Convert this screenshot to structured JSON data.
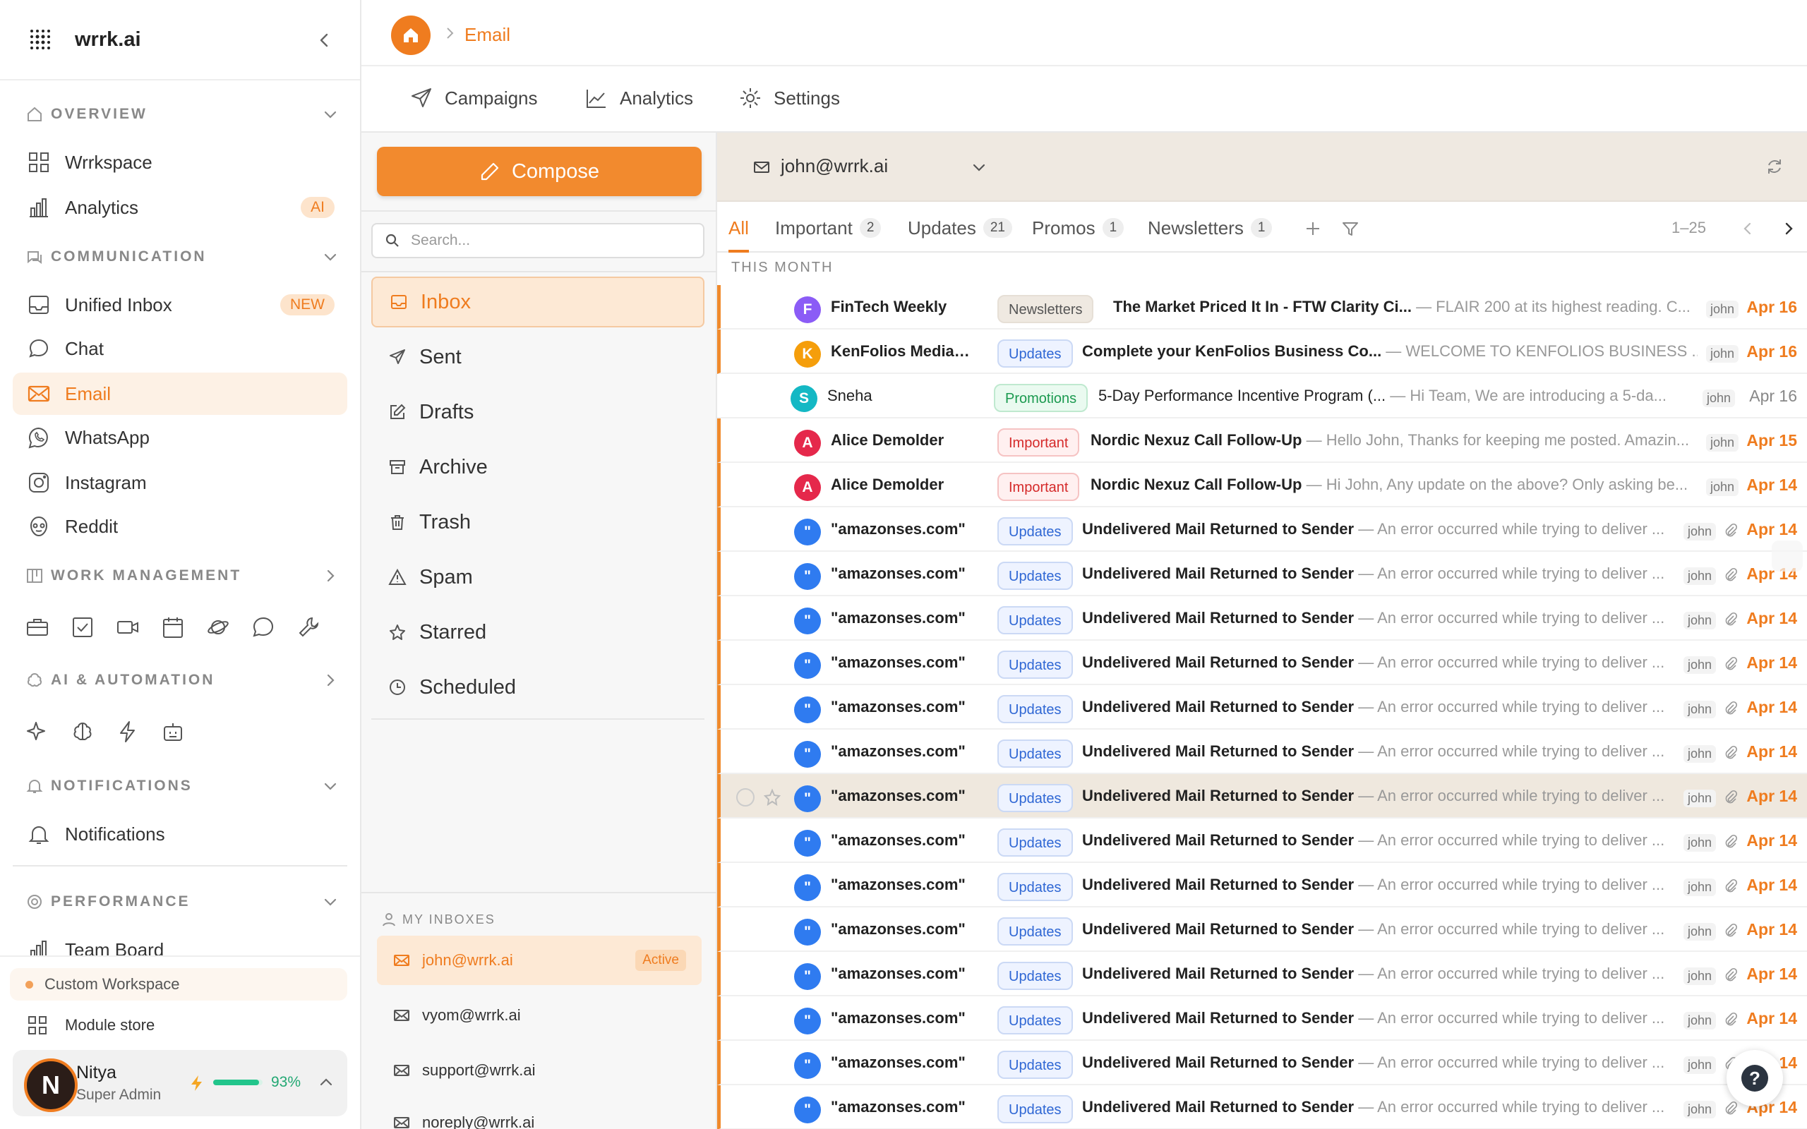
{
  "brand": {
    "name": "wrrk.ai"
  },
  "sidebar": {
    "sections": {
      "overview": "OVERVIEW",
      "communication": "COMMUNICATION",
      "work_management": "WORK MANAGEMENT",
      "ai_automation": "AI & AUTOMATION",
      "notifications": "NOTIFICATIONS",
      "performance": "PERFORMANCE"
    },
    "overview_items": [
      {
        "label": "Wrrkspace",
        "icon": "grid-icon"
      },
      {
        "label": "Analytics",
        "icon": "bar-chart-icon",
        "badge": "AI"
      }
    ],
    "communication_items": [
      {
        "label": "Unified Inbox",
        "icon": "inbox-icon",
        "badge": "NEW"
      },
      {
        "label": "Chat",
        "icon": "chat-bubble-icon"
      },
      {
        "label": "Email",
        "icon": "mail-icon"
      },
      {
        "label": "WhatsApp",
        "icon": "whatsapp-icon"
      },
      {
        "label": "Instagram",
        "icon": "instagram-icon"
      },
      {
        "label": "Reddit",
        "icon": "reddit-icon"
      }
    ],
    "work_icons": [
      "briefcase-icon",
      "checkbox-icon",
      "video-icon",
      "calendar-icon",
      "planet-icon",
      "message-icon",
      "wrench-icon"
    ],
    "ai_icons": [
      "sparkle-icon",
      "brain-icon",
      "lightning-icon",
      "bot-icon"
    ],
    "notifications_item": "Notifications",
    "performance_item": "Team Board",
    "custom_workspace": "Custom Workspace",
    "module_store": "Module store",
    "user": {
      "initial": "N",
      "name": "Nitya",
      "role": "Super Admin",
      "progress": "93%",
      "progress_value": 0.93
    }
  },
  "header": {
    "breadcrumb": "Email"
  },
  "top_tabs": [
    "Campaigns",
    "Analytics",
    "Settings"
  ],
  "folders": {
    "compose": "Compose",
    "search_placeholder": "Search...",
    "items": [
      "Inbox",
      "Sent",
      "Drafts",
      "Archive",
      "Trash",
      "Spam",
      "Starred",
      "Scheduled"
    ],
    "my_inboxes_title": "MY INBOXES",
    "inboxes": [
      {
        "email": "john@wrrk.ai",
        "badge": "Active"
      },
      {
        "email": "vyom@wrrk.ai"
      },
      {
        "email": "support@wrrk.ai"
      },
      {
        "email": "noreply@wrrk.ai"
      }
    ]
  },
  "mail": {
    "account": "john@wrrk.ai",
    "filter_tabs": [
      {
        "label": "All",
        "count": ""
      },
      {
        "label": "Important",
        "count": "2"
      },
      {
        "label": "Updates",
        "count": "21"
      },
      {
        "label": "Promos",
        "count": "1"
      },
      {
        "label": "Newsletters",
        "count": "1"
      }
    ],
    "range": "1–25",
    "group_label": "THIS MONTH",
    "colors": {
      "accent": "#ef7c1f",
      "purple": "#8b5cf6",
      "orange": "#f59e0b",
      "teal": "#14b8c4",
      "red": "#e5284b",
      "blue": "#2f7bf0"
    },
    "rows": [
      {
        "initial": "F",
        "color": "purple",
        "sender": "FinTech Weekly",
        "tag": "Newsletters",
        "subject": "The Market Priced It In - FTW Clarity Ci...",
        "snippet": " — FLAIR 200 at its highest reading. C...",
        "owner": "john",
        "date": "Apr 16",
        "unread": true,
        "attach": false
      },
      {
        "initial": "K",
        "color": "orange",
        "sender": "KenFolios Media Pri...",
        "tag": "Updates",
        "subject": "Complete your KenFolios Business Co...",
        "snippet": " — WELCOME TO KENFOLIOS BUSINESS ...",
        "owner": "john",
        "date": "Apr 16",
        "unread": true,
        "attach": false
      },
      {
        "initial": "S",
        "color": "teal",
        "sender": "Sneha",
        "tag": "Promotions",
        "subject": "5-Day Performance Incentive Program (...",
        "snippet": " — Hi Team, We are introducing a 5-da...",
        "owner": "john",
        "date": "Apr 16",
        "unread": false,
        "attach": false
      },
      {
        "initial": "A",
        "color": "red",
        "sender": "Alice Demolder",
        "tag": "Important",
        "subject": "Nordic Nexuz Call Follow-Up",
        "snippet": " — Hello John, Thanks for keeping me posted. Amazin...",
        "owner": "john",
        "date": "Apr 15",
        "unread": true,
        "attach": false
      },
      {
        "initial": "A",
        "color": "red",
        "sender": "Alice Demolder",
        "tag": "Important",
        "subject": "Nordic Nexuz Call Follow-Up",
        "snippet": " — Hi John, Any update on the above? Only asking be...",
        "owner": "john",
        "date": "Apr 14",
        "unread": true,
        "attach": false
      },
      {
        "initial": "\"",
        "color": "blue",
        "sender": "\"amazonses.com\"",
        "tag": "Updates",
        "subject": "Undelivered Mail Returned to Sender",
        "snippet": " — An error occurred while trying to deliver ...",
        "owner": "john",
        "date": "Apr 14",
        "unread": true,
        "attach": true
      },
      {
        "initial": "\"",
        "color": "blue",
        "sender": "\"amazonses.com\"",
        "tag": "Updates",
        "subject": "Undelivered Mail Returned to Sender",
        "snippet": " — An error occurred while trying to deliver ...",
        "owner": "john",
        "date": "Apr 14",
        "unread": true,
        "attach": true
      },
      {
        "initial": "\"",
        "color": "blue",
        "sender": "\"amazonses.com\"",
        "tag": "Updates",
        "subject": "Undelivered Mail Returned to Sender",
        "snippet": " — An error occurred while trying to deliver ...",
        "owner": "john",
        "date": "Apr 14",
        "unread": true,
        "attach": true
      },
      {
        "initial": "\"",
        "color": "blue",
        "sender": "\"amazonses.com\"",
        "tag": "Updates",
        "subject": "Undelivered Mail Returned to Sender",
        "snippet": " — An error occurred while trying to deliver ...",
        "owner": "john",
        "date": "Apr 14",
        "unread": true,
        "attach": true
      },
      {
        "initial": "\"",
        "color": "blue",
        "sender": "\"amazonses.com\"",
        "tag": "Updates",
        "subject": "Undelivered Mail Returned to Sender",
        "snippet": " — An error occurred while trying to deliver ...",
        "owner": "john",
        "date": "Apr 14",
        "unread": true,
        "attach": true
      },
      {
        "initial": "\"",
        "color": "blue",
        "sender": "\"amazonses.com\"",
        "tag": "Updates",
        "subject": "Undelivered Mail Returned to Sender",
        "snippet": " — An error occurred while trying to deliver ...",
        "owner": "john",
        "date": "Apr 14",
        "unread": true,
        "attach": true
      },
      {
        "initial": "\"",
        "color": "blue",
        "sender": "\"amazonses.com\"",
        "tag": "Updates",
        "subject": "Undelivered Mail Returned to Sender",
        "snippet": " — An error occurred while trying to deliver ...",
        "owner": "john",
        "date": "Apr 14",
        "unread": true,
        "attach": true,
        "hover": true
      },
      {
        "initial": "\"",
        "color": "blue",
        "sender": "\"amazonses.com\"",
        "tag": "Updates",
        "subject": "Undelivered Mail Returned to Sender",
        "snippet": " — An error occurred while trying to deliver ...",
        "owner": "john",
        "date": "Apr 14",
        "unread": true,
        "attach": true
      },
      {
        "initial": "\"",
        "color": "blue",
        "sender": "\"amazonses.com\"",
        "tag": "Updates",
        "subject": "Undelivered Mail Returned to Sender",
        "snippet": " — An error occurred while trying to deliver ...",
        "owner": "john",
        "date": "Apr 14",
        "unread": true,
        "attach": true
      },
      {
        "initial": "\"",
        "color": "blue",
        "sender": "\"amazonses.com\"",
        "tag": "Updates",
        "subject": "Undelivered Mail Returned to Sender",
        "snippet": " — An error occurred while trying to deliver ...",
        "owner": "john",
        "date": "Apr 14",
        "unread": true,
        "attach": true
      },
      {
        "initial": "\"",
        "color": "blue",
        "sender": "\"amazonses.com\"",
        "tag": "Updates",
        "subject": "Undelivered Mail Returned to Sender",
        "snippet": " — An error occurred while trying to deliver ...",
        "owner": "john",
        "date": "Apr 14",
        "unread": true,
        "attach": true
      },
      {
        "initial": "\"",
        "color": "blue",
        "sender": "\"amazonses.com\"",
        "tag": "Updates",
        "subject": "Undelivered Mail Returned to Sender",
        "snippet": " — An error occurred while trying to deliver ...",
        "owner": "john",
        "date": "Apr 14",
        "unread": true,
        "attach": true
      },
      {
        "initial": "\"",
        "color": "blue",
        "sender": "\"amazonses.com\"",
        "tag": "Updates",
        "subject": "Undelivered Mail Returned to Sender",
        "snippet": " — An error occurred while trying to deliver ...",
        "owner": "john",
        "date": "Apr 14",
        "unread": true,
        "attach": true
      },
      {
        "initial": "\"",
        "color": "blue",
        "sender": "\"amazonses.com\"",
        "tag": "Updates",
        "subject": "Undelivered Mail Returned to Sender",
        "snippet": " — An error occurred while trying to deliver ...",
        "owner": "john",
        "date": "Apr 14",
        "unread": true,
        "attach": true
      }
    ]
  },
  "help": {
    "label": "?"
  }
}
